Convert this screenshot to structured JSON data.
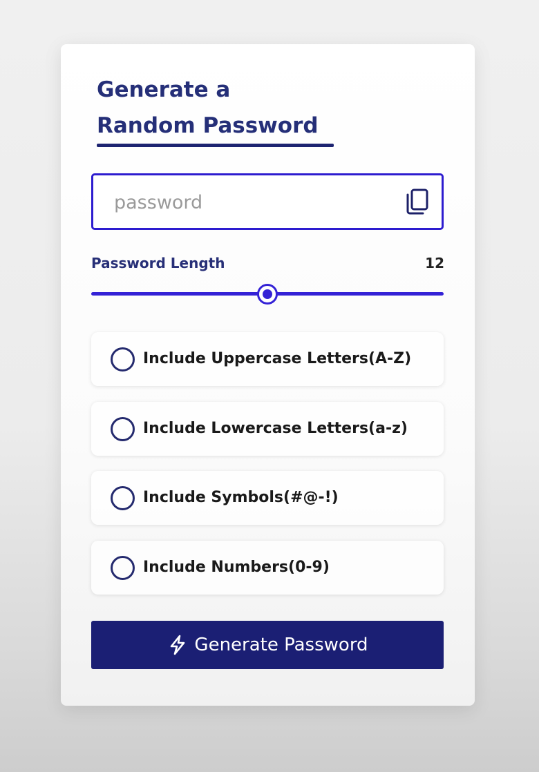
{
  "header": {
    "title_line1": "Generate a",
    "title_line2": "Random Password"
  },
  "password_field": {
    "value": "",
    "placeholder": "password",
    "copy_icon": "copy-icon"
  },
  "length": {
    "label": "Password Length",
    "value": "12",
    "slider_fraction": 0.5
  },
  "options": [
    {
      "label": "Include Uppercase Letters(A-Z)",
      "checked": false
    },
    {
      "label": "Include Lowercase Letters(a-z)",
      "checked": false
    },
    {
      "label": "Include Symbols(#@-!)",
      "checked": false
    },
    {
      "label": "Include Numbers(0-9)",
      "checked": false
    }
  ],
  "generate_button": {
    "label": "Generate Password",
    "icon": "lightning-bolt-icon"
  },
  "colors": {
    "title": "#252f78",
    "accent": "#3422d6",
    "button_bg": "#1b1f74",
    "radio_border": "#242a6e"
  }
}
